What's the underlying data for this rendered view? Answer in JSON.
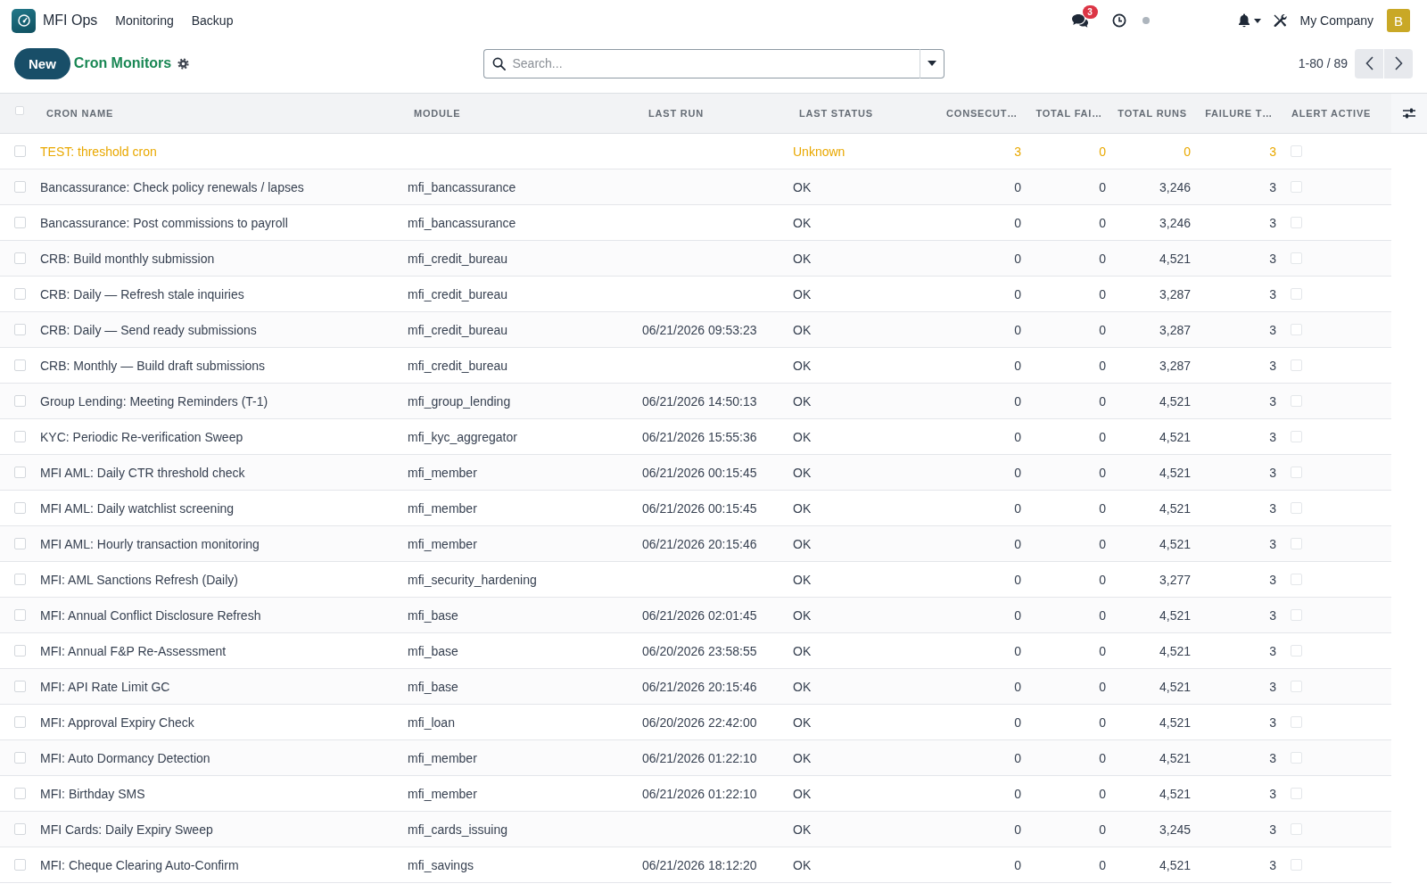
{
  "navbar": {
    "app_name": "MFI Ops",
    "menus": [
      {
        "label": "Monitoring"
      },
      {
        "label": "Backup"
      }
    ],
    "messages_badge": "3",
    "company": "My Company",
    "avatar_letter": "B"
  },
  "control_panel": {
    "new_button": "New",
    "breadcrumb": "Cron Monitors",
    "search": {
      "placeholder": "Search..."
    },
    "pager": "1-80 / 89"
  },
  "table": {
    "all_selected": false,
    "columns": [
      {
        "label": "CRON NAME"
      },
      {
        "label": "MODULE"
      },
      {
        "label": "LAST RUN"
      },
      {
        "label": "LAST STATUS"
      },
      {
        "label": "CONSECUT…"
      },
      {
        "label": "TOTAL FAI…"
      },
      {
        "label": "TOTAL RUNS"
      },
      {
        "label": "FAILURE T…"
      },
      {
        "label": "ALERT ACTIVE"
      }
    ],
    "rows": [
      {
        "selected": false,
        "warning": true,
        "cron_name": "TEST: threshold cron",
        "last_status": "Unknown",
        "column_5": "3",
        "column_6": "0",
        "total_runs": "0",
        "column_8": "3",
        "alert_active": false
      },
      {
        "selected": false,
        "warning": false,
        "cron_name": "Bancassurance: Check policy renewals / lapses",
        "module": "mfi_bancassurance",
        "last_status": "OK",
        "column_5": "0",
        "column_6": "0",
        "total_runs": "3,246",
        "column_8": "3",
        "alert_active": false
      },
      {
        "selected": false,
        "warning": false,
        "cron_name": "Bancassurance: Post commissions to payroll",
        "module": "mfi_bancassurance",
        "last_status": "OK",
        "column_5": "0",
        "column_6": "0",
        "total_runs": "3,246",
        "column_8": "3",
        "alert_active": false
      },
      {
        "selected": false,
        "warning": false,
        "cron_name": "CRB: Build monthly submission",
        "module": "mfi_credit_bureau",
        "last_status": "OK",
        "column_5": "0",
        "column_6": "0",
        "total_runs": "4,521",
        "column_8": "3",
        "alert_active": false
      },
      {
        "selected": false,
        "warning": false,
        "cron_name": "CRB: Daily — Refresh stale inquiries",
        "module": "mfi_credit_bureau",
        "last_status": "OK",
        "column_5": "0",
        "column_6": "0",
        "total_runs": "3,287",
        "column_8": "3",
        "alert_active": false
      },
      {
        "selected": false,
        "warning": false,
        "cron_name": "CRB: Daily — Send ready submissions",
        "module": "mfi_credit_bureau",
        "last_run": "06/21/2026 09:53:23",
        "last_status": "OK",
        "column_5": "0",
        "column_6": "0",
        "total_runs": "3,287",
        "column_8": "3",
        "alert_active": false
      },
      {
        "selected": false,
        "warning": false,
        "cron_name": "CRB: Monthly — Build draft submissions",
        "module": "mfi_credit_bureau",
        "last_status": "OK",
        "column_5": "0",
        "column_6": "0",
        "total_runs": "3,287",
        "column_8": "3",
        "alert_active": false
      },
      {
        "selected": false,
        "warning": false,
        "cron_name": "Group Lending: Meeting Reminders (T-1)",
        "module": "mfi_group_lending",
        "last_run": "06/21/2026 14:50:13",
        "last_status": "OK",
        "column_5": "0",
        "column_6": "0",
        "total_runs": "4,521",
        "column_8": "3",
        "alert_active": false
      },
      {
        "selected": false,
        "warning": false,
        "cron_name": "KYC: Periodic Re-verification Sweep",
        "module": "mfi_kyc_aggregator",
        "last_run": "06/21/2026 15:55:36",
        "last_status": "OK",
        "column_5": "0",
        "column_6": "0",
        "total_runs": "4,521",
        "column_8": "3",
        "alert_active": false
      },
      {
        "selected": false,
        "warning": false,
        "cron_name": "MFI AML: Daily CTR threshold check",
        "module": "mfi_member",
        "last_run": "06/21/2026 00:15:45",
        "last_status": "OK",
        "column_5": "0",
        "column_6": "0",
        "total_runs": "4,521",
        "column_8": "3",
        "alert_active": false
      },
      {
        "selected": false,
        "warning": false,
        "cron_name": "MFI AML: Daily watchlist screening",
        "module": "mfi_member",
        "last_run": "06/21/2026 00:15:45",
        "last_status": "OK",
        "column_5": "0",
        "column_6": "0",
        "total_runs": "4,521",
        "column_8": "3",
        "alert_active": false
      },
      {
        "selected": false,
        "warning": false,
        "cron_name": "MFI AML: Hourly transaction monitoring",
        "module": "mfi_member",
        "last_run": "06/21/2026 20:15:46",
        "last_status": "OK",
        "column_5": "0",
        "column_6": "0",
        "total_runs": "4,521",
        "column_8": "3",
        "alert_active": false
      },
      {
        "selected": false,
        "warning": false,
        "cron_name": "MFI: AML Sanctions Refresh (Daily)",
        "module": "mfi_security_hardening",
        "last_status": "OK",
        "column_5": "0",
        "column_6": "0",
        "total_runs": "3,277",
        "column_8": "3",
        "alert_active": false
      },
      {
        "selected": false,
        "warning": false,
        "cron_name": "MFI: Annual Conflict Disclosure Refresh",
        "module": "mfi_base",
        "last_run": "06/21/2026 02:01:45",
        "last_status": "OK",
        "column_5": "0",
        "column_6": "0",
        "total_runs": "4,521",
        "column_8": "3",
        "alert_active": false
      },
      {
        "selected": false,
        "warning": false,
        "cron_name": "MFI: Annual F&P Re-Assessment",
        "module": "mfi_base",
        "last_run": "06/20/2026 23:58:55",
        "last_status": "OK",
        "column_5": "0",
        "column_6": "0",
        "total_runs": "4,521",
        "column_8": "3",
        "alert_active": false
      },
      {
        "selected": false,
        "warning": false,
        "cron_name": "MFI: API Rate Limit GC",
        "module": "mfi_base",
        "last_run": "06/21/2026 20:15:46",
        "last_status": "OK",
        "column_5": "0",
        "column_6": "0",
        "total_runs": "4,521",
        "column_8": "3",
        "alert_active": false
      },
      {
        "selected": false,
        "warning": false,
        "cron_name": "MFI: Approval Expiry Check",
        "module": "mfi_loan",
        "last_run": "06/20/2026 22:42:00",
        "last_status": "OK",
        "column_5": "0",
        "column_6": "0",
        "total_runs": "4,521",
        "column_8": "3",
        "alert_active": false
      },
      {
        "selected": false,
        "warning": false,
        "cron_name": "MFI: Auto Dormancy Detection",
        "module": "mfi_member",
        "last_run": "06/21/2026 01:22:10",
        "last_status": "OK",
        "column_5": "0",
        "column_6": "0",
        "total_runs": "4,521",
        "column_8": "3",
        "alert_active": false
      },
      {
        "selected": false,
        "warning": false,
        "cron_name": "MFI: Birthday SMS",
        "module": "mfi_member",
        "last_run": "06/21/2026 01:22:10",
        "last_status": "OK",
        "column_5": "0",
        "column_6": "0",
        "total_runs": "4,521",
        "column_8": "3",
        "alert_active": false
      },
      {
        "selected": false,
        "warning": false,
        "cron_name": "MFI Cards: Daily Expiry Sweep",
        "module": "mfi_cards_issuing",
        "last_status": "OK",
        "column_5": "0",
        "column_6": "0",
        "total_runs": "3,245",
        "column_8": "3",
        "alert_active": false
      },
      {
        "selected": false,
        "warning": false,
        "cron_name": "MFI: Cheque Clearing Auto-Confirm",
        "module": "mfi_savings",
        "last_run": "06/21/2026 18:12:20",
        "last_status": "OK",
        "column_5": "0",
        "column_6": "0",
        "total_runs": "4,521",
        "column_8": "3",
        "alert_active": false
      }
    ]
  }
}
